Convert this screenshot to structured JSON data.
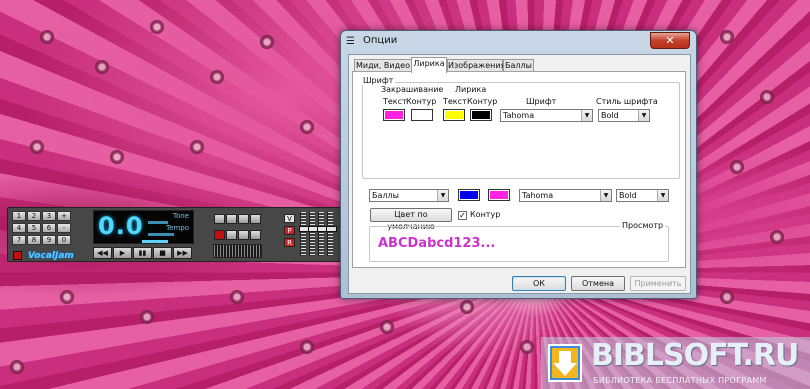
{
  "player": {
    "numpad": [
      "1",
      "2",
      "3",
      "+",
      "4",
      "5",
      "6",
      "-",
      "7",
      "8",
      "9",
      "0",
      "0"
    ],
    "display_value": "0.0",
    "tone_label": "Tone",
    "tempo_label": "Tempo",
    "transport": [
      "◀◀",
      "▶",
      "▮▮",
      "■",
      "▶▶"
    ],
    "logo": "VocalJam",
    "side_buttons": [
      "V",
      "P",
      "R"
    ]
  },
  "dialog": {
    "title": "Опции",
    "close_glyph": "✕",
    "tabs": [
      {
        "label": "Миди, Видео"
      },
      {
        "label": "Лирика"
      },
      {
        "label": "Изображения"
      },
      {
        "label": "Баллы"
      }
    ],
    "font_group": {
      "title": "Шрифт",
      "fill_header": "Закрашивание",
      "fill_text_col": "Текст",
      "fill_outline_col": "Контур",
      "lyrics_header": "Лирика",
      "lyrics_text_col": "Текст",
      "lyrics_outline_col": "Контур",
      "font_header": "Шрифт",
      "style_header": "Стиль шрифта",
      "row1": {
        "colors": [
          "#ff22e0",
          "#ffffff",
          "#ffff00",
          "#000000"
        ],
        "font": "Tahoma",
        "style": "Bold"
      }
    },
    "scores_row": {
      "target": "Баллы",
      "colors": [
        "#0000ee",
        "#ff22e0"
      ],
      "font": "Tahoma",
      "style": "Bold"
    },
    "default_color_button": "Цвет по умолчанию",
    "outline_checkbox": {
      "label": "Контур",
      "checked": true,
      "mark": "✓"
    },
    "preview": {
      "title": "Просмотр",
      "text": "ABCDabcd123..."
    },
    "buttons": {
      "ok": "ОК",
      "cancel": "Отмена",
      "apply": "Применить"
    }
  },
  "watermark": {
    "title": "BIBLSOFT.RU",
    "subtitle": "БИБЛИОТЕКА БЕСПЛАТНЫХ ПРОГРАММ"
  }
}
